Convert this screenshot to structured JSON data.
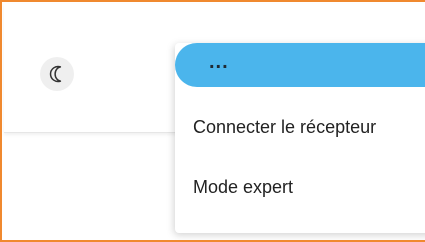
{
  "header": {
    "theme_toggle_icon": "crescent-moon-icon"
  },
  "dropdown": {
    "trigger_label": "...",
    "trigger_color": "#4BB5EC",
    "items": [
      {
        "label": "Connecter le récepteur"
      },
      {
        "label": "Mode expert"
      }
    ]
  },
  "colors": {
    "frame_border": "#F0892F",
    "toggle_background": "#efefef"
  }
}
